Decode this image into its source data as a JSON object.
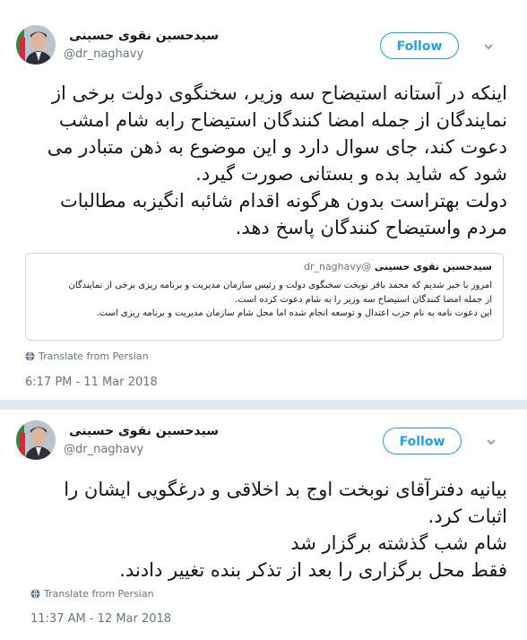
{
  "tweets": [
    {
      "author_name": "سیدحسین نقوی حسینی",
      "handle": "@dr_naghavy",
      "follow_label": "Follow",
      "text_lines": [
        "اینکه در آستانه استیضاح سه وزیر، سخنگوی دولت برخی از",
        "نمایندگان از جمله امضا کنندگان  استیضاح رابه شام امشب",
        "دعوت کند، جای سوال دارد و این موضوع به ذهن متبادر می",
        "شود که شاید بده و بستانی صورت گیرد.",
        "دولت بهتراست بدون هرگونه اقدام شائبه انگیزبه مطالبات",
        "مردم واستیضاح کنندگان پاسخ دهد."
      ],
      "quote": {
        "author_name": "سیدحسین نقوی حسینی",
        "handle": "@dr_naghavy",
        "text_lines": [
          "امروز با خبر شدیم که محمد باقر نوبخت سخنگوی دولت و رئیس سازمان مدیریت و برنامه ریزی برخی از نمایندگان",
          "از جمله امضا کنندگان استیضاح سه وزیر را به شام دعوت کرده است.",
          "این دعوت نامه به نام حزب اعتدال و توسعه انجام شده اما محل شام سازمان مدیریت و برنامه ریزی است."
        ]
      },
      "translate_label": "Translate from Persian",
      "timestamp": "6:17 PM - 11 Mar 2018"
    },
    {
      "author_name": "سیدحسین نقوی حسینی",
      "handle": "@dr_naghavy",
      "follow_label": "Follow",
      "text_lines": [
        "بیانیه دفترآقای نوبخت اوج بد اخلاقی و درغگویی ایشان را",
        "اثبات کرد.",
        "شام شب گذشته برگزار شد",
        "فقط محل برگزاری را بعد از تذکر بنده تغییر دادند."
      ],
      "translate_label": "Translate from Persian",
      "timestamp": "11:37 AM - 12 Mar 2018"
    }
  ],
  "colors": {
    "accent": "#1da1f2",
    "muted": "#657786",
    "text": "#14171a",
    "border": "#e1e8ed"
  }
}
